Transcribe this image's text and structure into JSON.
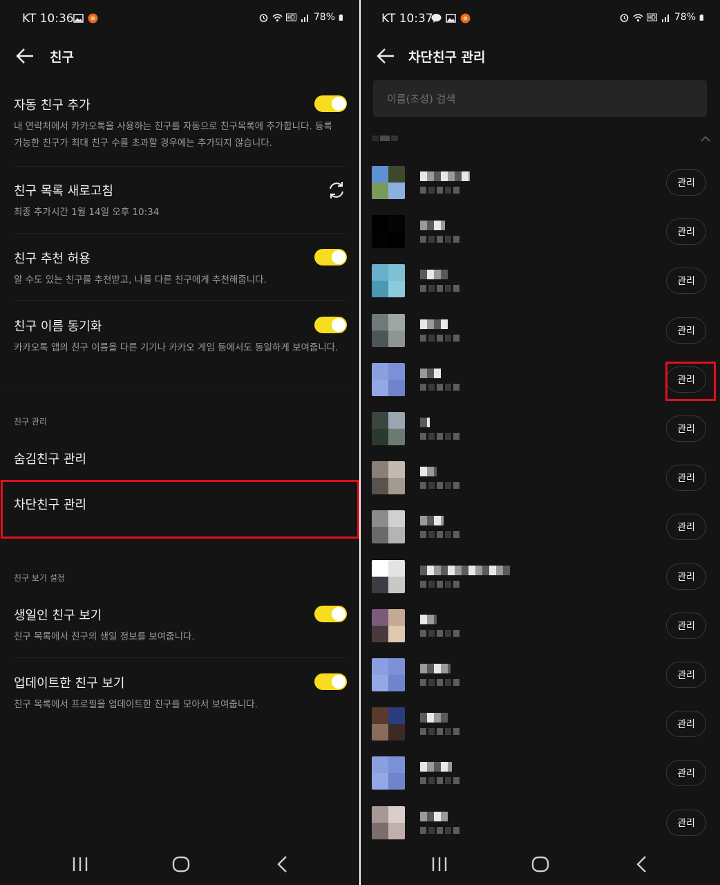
{
  "left": {
    "status": {
      "time": "KT 10:36",
      "battery": "78%"
    },
    "header": {
      "title": "친구"
    },
    "settings": {
      "auto_add": {
        "title": "자동 친구 추가",
        "desc": "내 연락처에서 카카오톡을 사용하는 친구를 자동으로 친구목록에 추가합니다. 등록 가능한 친구가 최대 친구 수를 초과할 경우에는 추가되지 않습니다.",
        "enabled": true
      },
      "refresh": {
        "title": "친구 목록 새로고침",
        "desc": "최종 추가시간 1월 14일 오후 10:34"
      },
      "recommend": {
        "title": "친구 추천 허용",
        "desc": "알 수도 있는 친구를 추천받고, 나를 다른 친구에게 추천해줍니다.",
        "enabled": true
      },
      "name_sync": {
        "title": "친구 이름 동기화",
        "desc": "카카오톡 앱의 친구 이름을 다른 기기나 카카오 게임 등에서도 동일하게 보여줍니다.",
        "enabled": true
      }
    },
    "manage_section": {
      "label": "친구 관리",
      "hidden": "숨김친구 관리",
      "blocked": "차단친구 관리"
    },
    "view_section": {
      "label": "친구 보기 설정",
      "birthday": {
        "title": "생일인 친구 보기",
        "desc": "친구 목록에서 친구의 생일 정보를 보여줍니다.",
        "enabled": true
      },
      "updated": {
        "title": "업데이트한 친구 보기",
        "desc": "친구 목록에서 프로필을 업데이트한 친구를 모아서 보여줍니다.",
        "enabled": true
      }
    }
  },
  "right": {
    "status": {
      "time": "KT 10:37",
      "battery": "78%"
    },
    "header": {
      "title": "차단친구 관리"
    },
    "search": {
      "placeholder": "이름(초성) 검색"
    },
    "manage_label": "관리",
    "accent": "#f6dd1f",
    "highlight_color": "#e0101e",
    "blocked_friends": [
      {
        "avatar_colors": [
          "#5f8fd4",
          "#3d4a2e",
          "#7a9a5c",
          "#8cb0e0"
        ]
      },
      {
        "avatar_colors": [
          "#000000",
          "#050505",
          "#020202",
          "#000000"
        ]
      },
      {
        "avatar_colors": [
          "#6ab0c8",
          "#7ec0d4",
          "#4a98b4",
          "#8accdc"
        ]
      },
      {
        "avatar_colors": [
          "#6e7a7c",
          "#a0a6a4",
          "#4c5658",
          "#8e9694"
        ]
      },
      {
        "avatar_colors": [
          "#8a9ee0",
          "#7c90d8",
          "#95a8e6",
          "#6f84cc"
        ]
      },
      {
        "avatar_colors": [
          "#3c4640",
          "#9aa6b0",
          "#2a3a2c",
          "#6c7a70"
        ]
      },
      {
        "avatar_colors": [
          "#8a8078",
          "#c2bab0",
          "#5a524c",
          "#a49a90"
        ]
      },
      {
        "avatar_colors": [
          "#8c8c8c",
          "#d0d0d0",
          "#6a6a6a",
          "#b4b4b4"
        ]
      },
      {
        "avatar_colors": [
          "#ffffff",
          "#e4e4e4",
          "#3c3c44",
          "#c8c8c8"
        ]
      },
      {
        "avatar_colors": [
          "#7c5a7a",
          "#c6a896",
          "#4a3a40",
          "#e0c8b0"
        ]
      },
      {
        "avatar_colors": [
          "#8a9ee0",
          "#7c90d8",
          "#95a8e6",
          "#6f84cc"
        ]
      },
      {
        "avatar_colors": [
          "#5a3a2c",
          "#2a3c7c",
          "#8a6a5a",
          "#3c2a24"
        ]
      },
      {
        "avatar_colors": [
          "#8a9ee0",
          "#7c90d8",
          "#95a8e6",
          "#6f84cc"
        ]
      },
      {
        "avatar_colors": [
          "#a89894",
          "#d8cccc",
          "#7c6c6c",
          "#c0b0ac"
        ]
      }
    ]
  }
}
